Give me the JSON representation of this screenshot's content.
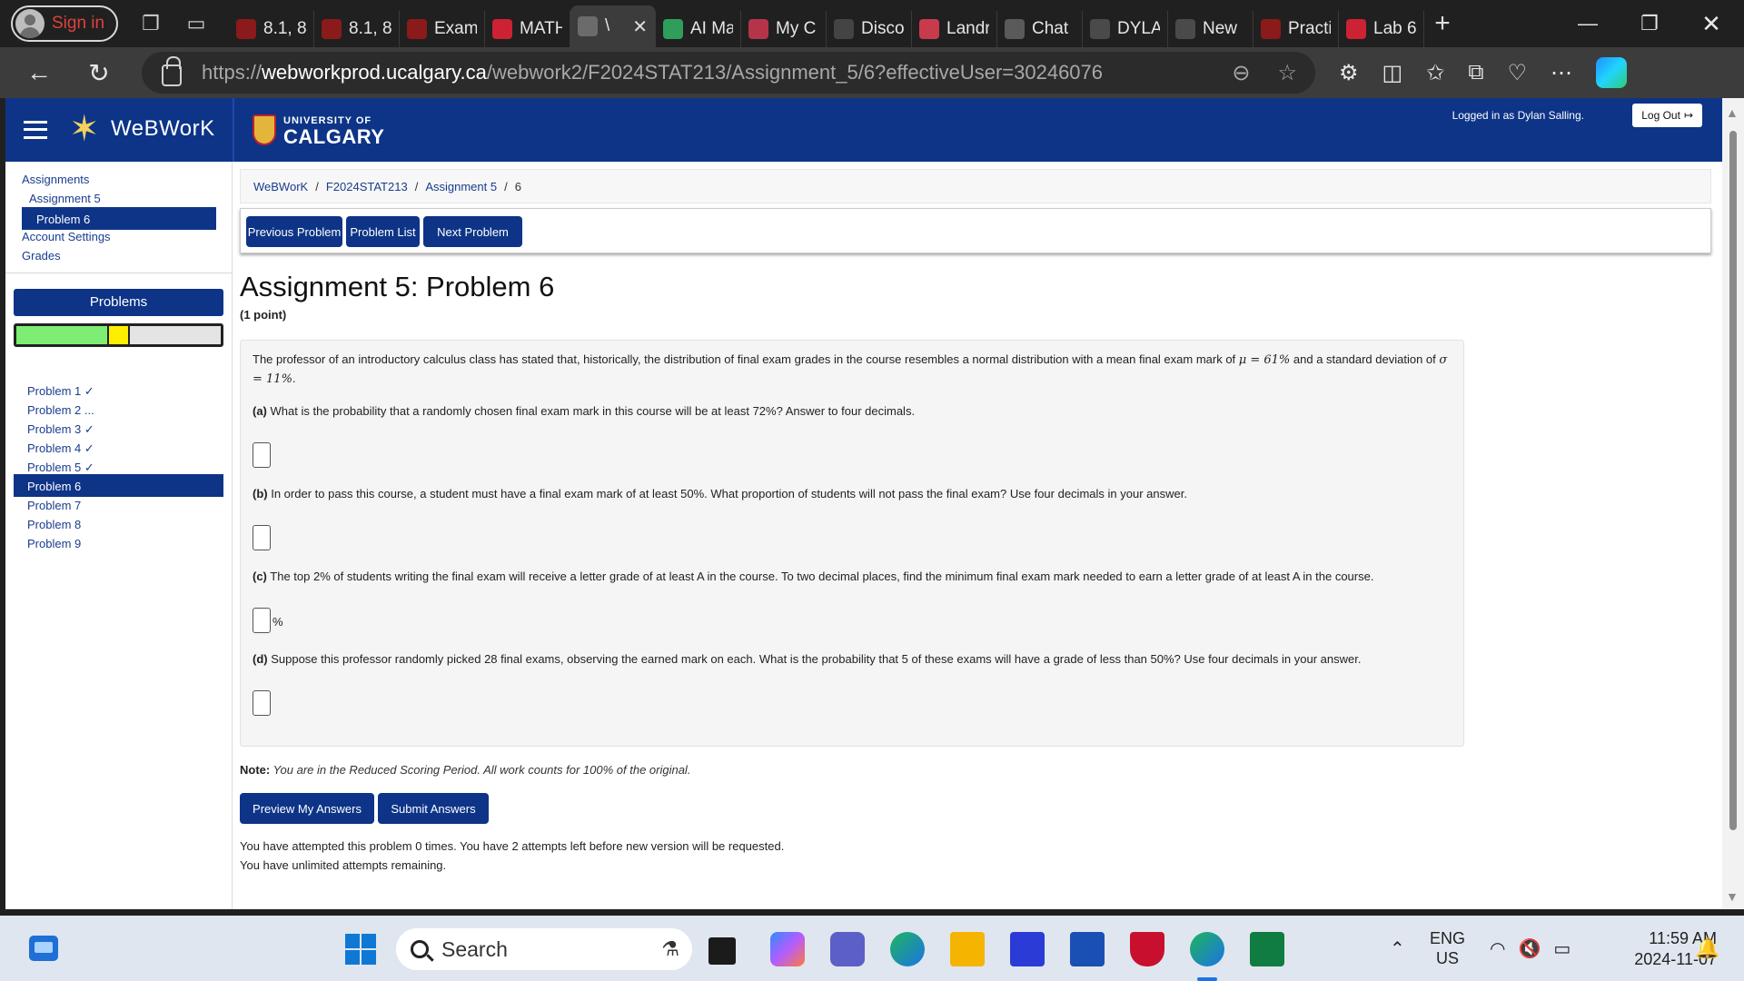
{
  "browser": {
    "signin_label": "Sign in",
    "tabs": [
      {
        "title": "8.1, 8",
        "fav": "#8b1a1a",
        "active": false
      },
      {
        "title": "8.1, 8",
        "fav": "#8b1a1a",
        "active": false
      },
      {
        "title": "Exam",
        "fav": "#8b1a1a",
        "active": false
      },
      {
        "title": "MATH",
        "fav": "#cc2233",
        "active": false
      },
      {
        "title": "\\",
        "fav": "#6b6b6b",
        "active": true
      },
      {
        "title": "AI Ma",
        "fav": "#2e9e5a",
        "active": false
      },
      {
        "title": "My C",
        "fav": "#b5344a",
        "active": false
      },
      {
        "title": "Disco",
        "fav": "#444444",
        "active": false
      },
      {
        "title": "Landr",
        "fav": "#c83b4d",
        "active": false
      },
      {
        "title": "Chat",
        "fav": "#5a5a5a",
        "active": false
      },
      {
        "title": "DYLA",
        "fav": "#4a4a4a",
        "active": false
      },
      {
        "title": "New",
        "fav": "#4a4a4a",
        "active": false
      },
      {
        "title": "Practi",
        "fav": "#8b1a1a",
        "active": false
      },
      {
        "title": "Lab 6",
        "fav": "#cc2233",
        "active": false
      }
    ],
    "url_prefix": "https://",
    "url_host": "webworkprod.ucalgary.ca",
    "url_path": "/webwork2/F2024STAT213/Assignment_5/6?effectiveUser=30246076"
  },
  "header": {
    "logo_text": "WeBWorK",
    "uc_small": "UNIVERSITY OF",
    "uc_big": "CALGARY",
    "logged_in": "Logged in as Dylan Salling.",
    "logout_label": "Log Out"
  },
  "sidebar": {
    "assignments": "Assignments",
    "assignment5": "Assignment 5",
    "problem6": "Problem 6",
    "account_settings": "Account Settings",
    "grades": "Grades",
    "problems_header": "Problems",
    "progress": {
      "correct": 4,
      "partial": 1,
      "total": 9
    },
    "problems": [
      {
        "label": "Problem 1 ✓"
      },
      {
        "label": "Problem 2 ..."
      },
      {
        "label": "Problem 3 ✓"
      },
      {
        "label": "Problem 4 ✓"
      },
      {
        "label": "Problem 5 ✓"
      },
      {
        "label": "Problem 6"
      },
      {
        "label": "Problem 7"
      },
      {
        "label": "Problem 8"
      },
      {
        "label": "Problem 9"
      }
    ]
  },
  "main": {
    "breadcrumb": [
      "WeBWorK",
      "F2024STAT213",
      "Assignment 5",
      "6"
    ],
    "prev_label": "Previous Problem",
    "list_label": "Problem List",
    "next_label": "Next Problem",
    "title": "Assignment 5: Problem 6",
    "points": "(1 point)",
    "intro_1": "The professor of an introductory calculus class has stated that, historically, the distribution of final exam grades in the course resembles a normal distribution with a mean final exam mark of ",
    "mu_expr": "μ = 61%",
    "intro_2": " and a standard deviation of ",
    "sigma_expr": "σ = 11%",
    "intro_3": ".",
    "qa_tag": "(a)",
    "qa": " What is the probability that a randomly chosen final exam mark in this course will be at least 72%? Answer to four decimals.",
    "qb_tag": "(b)",
    "qb": " In order to pass this course, a student must have a final exam mark of at least 50%. What proportion of students will not pass the final exam? Use four decimals in your answer.",
    "qc_tag": "(c)",
    "qc": " The top 2% of students writing the final exam will receive a letter grade of at least A in the course. To two decimal places, find the minimum final exam mark needed to earn a letter grade of at least A in the course.",
    "qc_unit": "%",
    "qd_tag": "(d)",
    "qd": " Suppose this professor randomly picked 28 final exams, observing the earned mark on each. What is the probability that 5 of these exams will have a grade of less than 50%? Use four decimals in your answer.",
    "note_label": "Note:",
    "note_text": " You are in the Reduced Scoring Period. All work counts for 100% of the original.",
    "preview_label": "Preview My Answers",
    "submit_label": "Submit Answers",
    "attempts_1": "You have attempted this problem 0 times. You have 2 attempts left before new version will be requested.",
    "attempts_2": "You have unlimited attempts remaining."
  },
  "taskbar": {
    "search_placeholder": "Search",
    "lang_1": "ENG",
    "lang_2": "US",
    "time": "11:59 AM",
    "date": "2024-11-07"
  },
  "colors": {
    "brand": "#0d3487",
    "progress_correct": "#7ded73",
    "progress_partial": "#ffee00",
    "progress_empty": "#e4e4e4"
  }
}
